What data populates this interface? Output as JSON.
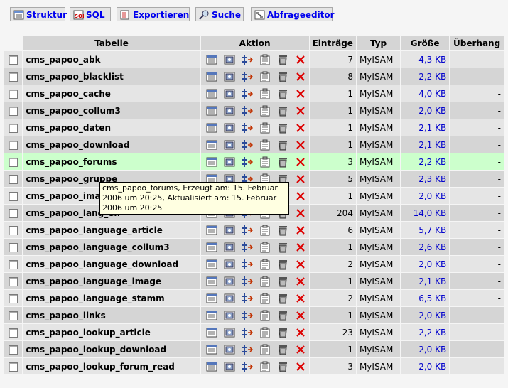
{
  "tabs": [
    {
      "label": "Struktur",
      "icon": "structure-icon"
    },
    {
      "label": "SQL",
      "icon": "sql-icon"
    },
    {
      "label": "Exportieren",
      "icon": "export-icon"
    },
    {
      "label": "Suche",
      "icon": "search-icon"
    },
    {
      "label": "Abfrageeditor",
      "icon": "query-editor-icon"
    }
  ],
  "headers": {
    "table": "Tabelle",
    "action": "Aktion",
    "rows": "Einträge",
    "type": "Typ",
    "size": "Größe",
    "overhead": "Überhang"
  },
  "action_icons": [
    "browse-icon",
    "select-icon",
    "insert-icon",
    "properties-icon",
    "empty-icon",
    "drop-icon"
  ],
  "rows": [
    {
      "name": "cms_papoo_abk",
      "entries": "7",
      "type": "MyISAM",
      "size": "4,3 KB",
      "overhead": "-"
    },
    {
      "name": "cms_papoo_blacklist",
      "entries": "8",
      "type": "MyISAM",
      "size": "2,2 KB",
      "overhead": "-"
    },
    {
      "name": "cms_papoo_cache",
      "entries": "1",
      "type": "MyISAM",
      "size": "4,0 KB",
      "overhead": "-"
    },
    {
      "name": "cms_papoo_collum3",
      "entries": "1",
      "type": "MyISAM",
      "size": "2,0 KB",
      "overhead": "-"
    },
    {
      "name": "cms_papoo_daten",
      "entries": "1",
      "type": "MyISAM",
      "size": "2,1 KB",
      "overhead": "-"
    },
    {
      "name": "cms_papoo_download",
      "entries": "1",
      "type": "MyISAM",
      "size": "2,1 KB",
      "overhead": "-"
    },
    {
      "name": "cms_papoo_forums",
      "entries": "3",
      "type": "MyISAM",
      "size": "2,2 KB",
      "overhead": "-"
    },
    {
      "name": "cms_papoo_gruppe",
      "entries": "5",
      "type": "MyISAM",
      "size": "2,3 KB",
      "overhead": "-"
    },
    {
      "name": "cms_papoo_images",
      "entries": "1",
      "type": "MyISAM",
      "size": "2,0 KB",
      "overhead": "-"
    },
    {
      "name": "cms_papoo_lang_en",
      "entries": "204",
      "type": "MyISAM",
      "size": "14,0 KB",
      "overhead": "-"
    },
    {
      "name": "cms_papoo_language_article",
      "entries": "6",
      "type": "MyISAM",
      "size": "5,7 KB",
      "overhead": "-"
    },
    {
      "name": "cms_papoo_language_collum3",
      "entries": "1",
      "type": "MyISAM",
      "size": "2,6 KB",
      "overhead": "-"
    },
    {
      "name": "cms_papoo_language_download",
      "entries": "2",
      "type": "MyISAM",
      "size": "2,0 KB",
      "overhead": "-"
    },
    {
      "name": "cms_papoo_language_image",
      "entries": "1",
      "type": "MyISAM",
      "size": "2,1 KB",
      "overhead": "-"
    },
    {
      "name": "cms_papoo_language_stamm",
      "entries": "2",
      "type": "MyISAM",
      "size": "6,5 KB",
      "overhead": "-"
    },
    {
      "name": "cms_papoo_links",
      "entries": "1",
      "type": "MyISAM",
      "size": "2,0 KB",
      "overhead": "-"
    },
    {
      "name": "cms_papoo_lookup_article",
      "entries": "23",
      "type": "MyISAM",
      "size": "2,2 KB",
      "overhead": "-"
    },
    {
      "name": "cms_papoo_lookup_download",
      "entries": "1",
      "type": "MyISAM",
      "size": "2,0 KB",
      "overhead": "-"
    },
    {
      "name": "cms_papoo_lookup_forum_read",
      "entries": "3",
      "type": "MyISAM",
      "size": "2,0 KB",
      "overhead": "-"
    }
  ],
  "highlighted_row": 6,
  "tooltip": "cms_papoo_forums, Erzeugt am: 15. Februar 2006 um 20:25, Aktualisiert am: 15. Februar 2006 um 20:25",
  "colors": {
    "link": "#0000cc",
    "row_odd": "#e5e5e5",
    "row_even": "#d5d5d5",
    "row_highlight": "#ccffcc",
    "drop": "#dd0000"
  }
}
